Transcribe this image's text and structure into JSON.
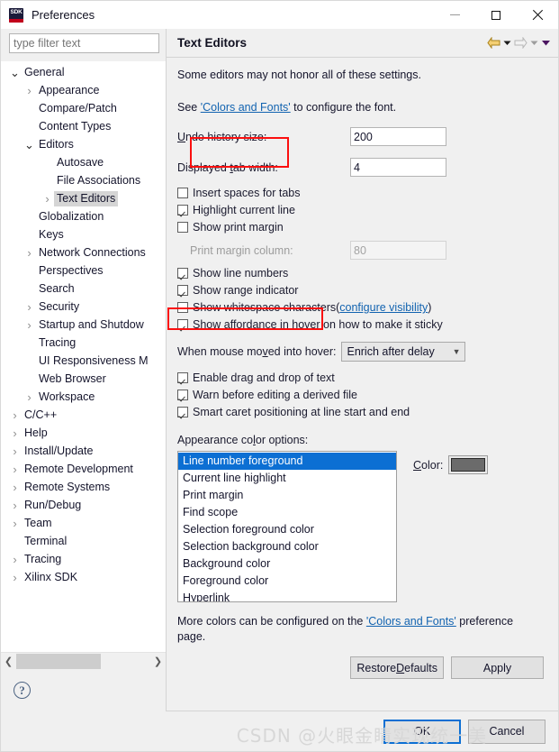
{
  "window": {
    "title": "Preferences",
    "icon": "sdk-icon",
    "icon_text": "SDK",
    "controls": {
      "minimize": "minimize-icon",
      "maximize": "maximize-icon",
      "close": "close-icon"
    }
  },
  "sidebar": {
    "filter": {
      "placeholder": "type filter text",
      "value": ""
    },
    "items": [
      {
        "label": "General",
        "depth": 0,
        "arrow": "open",
        "selected": false
      },
      {
        "label": "Appearance",
        "depth": 1,
        "arrow": "closed",
        "selected": false
      },
      {
        "label": "Compare/Patch",
        "depth": 1,
        "arrow": "none",
        "selected": false
      },
      {
        "label": "Content Types",
        "depth": 1,
        "arrow": "none",
        "selected": false
      },
      {
        "label": "Editors",
        "depth": 1,
        "arrow": "open",
        "selected": false
      },
      {
        "label": "Autosave",
        "depth": 2,
        "arrow": "none",
        "selected": false
      },
      {
        "label": "File Associations",
        "depth": 2,
        "arrow": "none",
        "selected": false
      },
      {
        "label": "Text Editors",
        "depth": 2,
        "arrow": "closed",
        "selected": true
      },
      {
        "label": "Globalization",
        "depth": 1,
        "arrow": "none",
        "selected": false
      },
      {
        "label": "Keys",
        "depth": 1,
        "arrow": "none",
        "selected": false
      },
      {
        "label": "Network Connections",
        "depth": 1,
        "arrow": "closed",
        "selected": false
      },
      {
        "label": "Perspectives",
        "depth": 1,
        "arrow": "none",
        "selected": false
      },
      {
        "label": "Search",
        "depth": 1,
        "arrow": "none",
        "selected": false
      },
      {
        "label": "Security",
        "depth": 1,
        "arrow": "closed",
        "selected": false
      },
      {
        "label": "Startup and Shutdow",
        "depth": 1,
        "arrow": "closed",
        "selected": false
      },
      {
        "label": "Tracing",
        "depth": 1,
        "arrow": "none",
        "selected": false
      },
      {
        "label": "UI Responsiveness M",
        "depth": 1,
        "arrow": "none",
        "selected": false
      },
      {
        "label": "Web Browser",
        "depth": 1,
        "arrow": "none",
        "selected": false
      },
      {
        "label": "Workspace",
        "depth": 1,
        "arrow": "closed",
        "selected": false
      },
      {
        "label": "C/C++",
        "depth": 0,
        "arrow": "closed",
        "selected": false
      },
      {
        "label": "Help",
        "depth": 0,
        "arrow": "closed",
        "selected": false
      },
      {
        "label": "Install/Update",
        "depth": 0,
        "arrow": "closed",
        "selected": false
      },
      {
        "label": "Remote Development",
        "depth": 0,
        "arrow": "closed",
        "selected": false
      },
      {
        "label": "Remote Systems",
        "depth": 0,
        "arrow": "closed",
        "selected": false
      },
      {
        "label": "Run/Debug",
        "depth": 0,
        "arrow": "closed",
        "selected": false
      },
      {
        "label": "Team",
        "depth": 0,
        "arrow": "closed",
        "selected": false
      },
      {
        "label": "Terminal",
        "depth": 0,
        "arrow": "none",
        "selected": false
      },
      {
        "label": "Tracing",
        "depth": 0,
        "arrow": "closed",
        "selected": false
      },
      {
        "label": "Xilinx SDK",
        "depth": 0,
        "arrow": "closed",
        "selected": false
      }
    ],
    "scrollbar": {
      "left_arrow": "chevron-left-icon",
      "right_arrow": "chevron-right-icon"
    },
    "help_icon": "help-question-icon",
    "help_glyph": "?"
  },
  "page": {
    "title": "Text Editors",
    "nav": {
      "back_icon": "back-arrow-icon",
      "back_menu_icon": "caret-down-icon",
      "forward_icon": "forward-arrow-icon",
      "forward_menu_icon": "caret-down-icon",
      "menu_icon": "caret-down-purple-icon"
    },
    "note": "Some editors may not honor all of these settings.",
    "see_prefix": "See ",
    "see_link": "'Colors and Fonts'",
    "see_suffix": " to configure the font.",
    "fields": [
      {
        "label_prefix": "U",
        "label_underline": "",
        "label": "Undo history size:",
        "value": "200",
        "enabled": true
      },
      {
        "label": "Displayed tab width:",
        "value": "4",
        "enabled": true
      }
    ],
    "undo_label": "Undo history size:",
    "undo_value": "200",
    "tab_label": "Displayed tab width:",
    "tab_value": "4",
    "print_margin_label": "Print margin column:",
    "print_margin_value": "80",
    "checkboxes": [
      {
        "label": "Insert spaces for tabs",
        "checked": false
      },
      {
        "label": "Highlight current line",
        "checked": true
      },
      {
        "label": "Show print margin",
        "checked": false
      }
    ],
    "show_line_numbers": {
      "label": "Show line numbers",
      "checked": true
    },
    "show_range_indicator": {
      "label": "Show range indicator",
      "checked": true
    },
    "show_whitespace": {
      "label": "Show whitespace characters ",
      "checked": false,
      "link": "configure visibility",
      "paren_open": "(",
      "paren_close": ")"
    },
    "show_affordance": {
      "label": "Show affordance in hover on how to make it sticky",
      "checked": true
    },
    "hover_combo": {
      "label": "When mouse moved into hover:",
      "value": "Enrich after delay",
      "caret_icon": "chevron-down-icon"
    },
    "checkboxes2": [
      {
        "label": "Enable drag and drop of text",
        "checked": true
      },
      {
        "label": "Warn before editing a derived file",
        "checked": true
      },
      {
        "label": "Smart caret positioning at line start and end",
        "checked": true
      }
    ],
    "appearance_label": "Appearance color options:",
    "color_options": [
      {
        "label": "Line number foreground",
        "selected": true
      },
      {
        "label": "Current line highlight",
        "selected": false
      },
      {
        "label": "Print margin",
        "selected": false
      },
      {
        "label": "Find scope",
        "selected": false
      },
      {
        "label": "Selection foreground color",
        "selected": false
      },
      {
        "label": "Selection background color",
        "selected": false
      },
      {
        "label": "Background color",
        "selected": false
      },
      {
        "label": "Foreground color",
        "selected": false
      },
      {
        "label": "Hyperlink",
        "selected": false
      }
    ],
    "color_label": "Color:",
    "color_swatch_value": "#6b6b6b",
    "more_colors_prefix": "More colors can be configured on the ",
    "more_colors_link": "'Colors and Fonts'",
    "more_colors_suffix": " preference page.",
    "restore_defaults_label": "Restore Defaults",
    "apply_label": "Apply"
  },
  "footer": {
    "ok_label": "OK",
    "cancel_label": "Cancel",
    "watermark": "CSDN @火眼金睛实现统一美"
  },
  "colors": {
    "selection_blue": "#0c6fd3",
    "link_blue": "#1263b0",
    "annotation_red": "#fb0f0f",
    "dialog_bg": "#f0f0f0",
    "tree_selection_gray": "#d5d5d5"
  }
}
